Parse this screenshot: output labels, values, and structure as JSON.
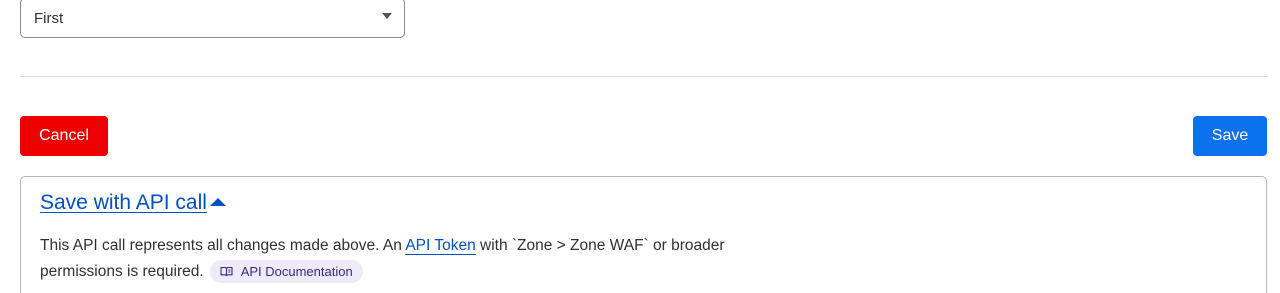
{
  "select": {
    "value": "First"
  },
  "actions": {
    "cancel_label": "Cancel",
    "save_label": "Save"
  },
  "api_section": {
    "title": "Save with API call",
    "text_before": "This API call represents all changes made above. An ",
    "token_link": "API Token",
    "text_middle": " with `Zone > Zone WAF` or broader permissions is required.",
    "doc_chip": "API Documentation"
  },
  "colors": {
    "cancel": "#ee0000",
    "save": "#0a72ef",
    "link": "#0051c3",
    "chip_bg": "#eeeaf9"
  },
  "icons": {
    "toggle": "caret-up-icon",
    "select": "chevron-down-icon",
    "doc": "book-icon"
  }
}
